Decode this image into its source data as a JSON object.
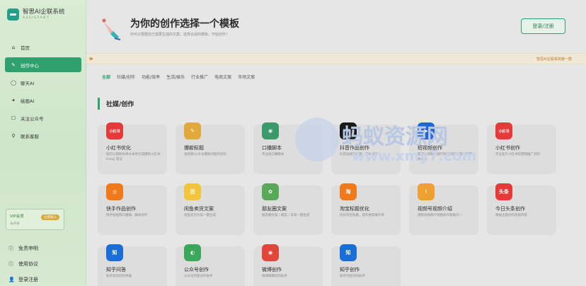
{
  "brand": {
    "title": "智思AI企联系统",
    "subtitle": "ASSISTANT"
  },
  "nav": [
    {
      "label": "首页",
      "icon": "home-icon",
      "glyph": "⌂"
    },
    {
      "label": "创作中心",
      "icon": "create-icon",
      "glyph": "✎",
      "active": true
    },
    {
      "label": "聊天AI",
      "icon": "chat-icon",
      "glyph": "◯"
    },
    {
      "label": "绘画AI",
      "icon": "paint-icon",
      "glyph": "✦"
    },
    {
      "label": "关注公众号",
      "icon": "follow-icon",
      "glyph": "☐"
    },
    {
      "label": "联系客服",
      "icon": "service-icon",
      "glyph": "⚲"
    }
  ],
  "vip": {
    "title": "VIP会员",
    "subtitle": "未开通",
    "button": "立即加入"
  },
  "side_bottom": [
    {
      "label": "免责申明",
      "icon": "info-icon",
      "glyph": "ⓘ"
    },
    {
      "label": "使用协议",
      "icon": "agreement-icon",
      "glyph": "ⓘ"
    },
    {
      "label": "登录注册",
      "icon": "user-icon",
      "glyph": "👤"
    }
  ],
  "hero": {
    "title": "为你的创作选择一个模板",
    "subtitle": "你可以根据自己需要生成的文案，选择合适的模板，开始创作！"
  },
  "login_button": "登录/注册",
  "notice": {
    "text": "智思AI企联系统第一群"
  },
  "tabs": [
    {
      "label": "全部",
      "active": true
    },
    {
      "label": "社媒/创作"
    },
    {
      "label": "功能/效率"
    },
    {
      "label": "生活/娱乐"
    },
    {
      "label": "行业推广"
    },
    {
      "label": "电商文案"
    },
    {
      "label": "市场文案"
    }
  ],
  "section": {
    "title": "社媒/创作"
  },
  "cards": [
    {
      "title": "小红书优化",
      "desc": "按可以帮助你将文本改写成爆款小红书 Emoji 笔记",
      "icon": "xiaohongshu-icon",
      "glyph": "小红书",
      "color": "#e53a3a"
    },
    {
      "title": "爆款标题",
      "desc": "短视频/公众号爆款问题的创作",
      "icon": "pen-icon",
      "glyph": "✎",
      "color": "#e0a93a"
    },
    {
      "title": "口播脚本",
      "desc": "专业短口播脚本",
      "icon": "camera-icon",
      "glyph": "◉",
      "color": "#3a9a6a"
    },
    {
      "title": "抖音作品创作",
      "desc": "抖音短视频创意，脚本创作",
      "icon": "douyin-icon",
      "glyph": "♪",
      "color": "#1a1a1a"
    },
    {
      "title": "短视频创作",
      "desc": "我可以帮助你进行短视频的分镜文案脚本创作",
      "icon": "video-icon",
      "glyph": "▶",
      "color": "#2166d8"
    },
    {
      "title": "小红书创作",
      "desc": "专业鉴于小红书的营销推广创作",
      "icon": "xiaohongshu-icon",
      "glyph": "小红书",
      "color": "#e53a3a"
    },
    {
      "title": "快手作品创作",
      "desc": "快手短视频口播稿、脚本创作",
      "icon": "kuaishou-icon",
      "glyph": "◎",
      "color": "#f07a1a"
    },
    {
      "title": "闲鱼卖货文案",
      "desc": "闲鱼卖货文案一键生成",
      "icon": "xianyu-icon",
      "glyph": "田",
      "color": "#f2c63a"
    },
    {
      "title": "朋友圈文案",
      "desc": "朋友圈文案 / 朋友 / 日常一键生成",
      "icon": "moments-icon",
      "glyph": "✿",
      "color": "#5aa85a"
    },
    {
      "title": "淘宝标题优化",
      "desc": "优化淘宝标题，提升搜索展示率",
      "icon": "taobao-icon",
      "glyph": "淘",
      "color": "#f07a1a"
    },
    {
      "title": "视频号视频介绍",
      "desc": "视频号视频介绍图表作者编写一",
      "icon": "channels-icon",
      "glyph": "⌇",
      "color": "#f0a030"
    },
    {
      "title": "今日头条创作",
      "desc": "根据主题创作优质内容",
      "icon": "toutiao-icon",
      "glyph": "头条",
      "color": "#e53a3a"
    },
    {
      "title": "知乎问答",
      "desc": "知乎高效创作神器",
      "icon": "zhihu-icon",
      "glyph": "知",
      "color": "#1a6ed8"
    },
    {
      "title": "公众号创作",
      "desc": "公众号内容创作助手",
      "icon": "wechat-mp-icon",
      "glyph": "◐",
      "color": "#3aa85a"
    },
    {
      "title": "微博创作",
      "desc": "微博精细创作助手",
      "icon": "weibo-icon",
      "glyph": "◉",
      "color": "#e0463a"
    },
    {
      "title": "知乎创作",
      "desc": "知乎内容创作助手",
      "icon": "zhihu-icon",
      "glyph": "知",
      "color": "#1a6ed8"
    }
  ],
  "watermark": {
    "text": "蚂蚁资源网",
    "url": "www.xmy7.com"
  }
}
